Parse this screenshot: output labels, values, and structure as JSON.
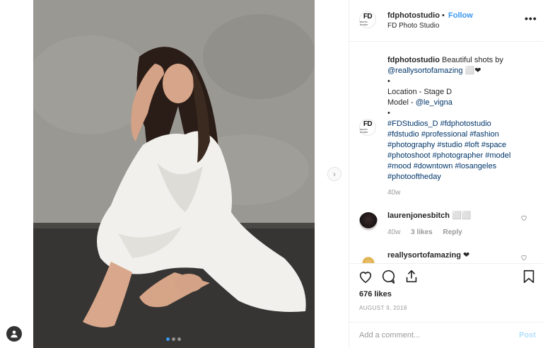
{
  "header": {
    "username": "fdphotostudio",
    "separator": "•",
    "follow_label": "Follow",
    "subtitle": "FD Photo Studio",
    "more_icon": "more-horizontal-icon",
    "logo_text": "FD",
    "logo_small": "PHOTO STUDIO"
  },
  "caption": {
    "username": "fdphotostudio",
    "text_1": "Beautiful shots by",
    "mention_1": "@reallysortofamazing",
    "emoji_1": "⬜❤",
    "bullet": "•",
    "location": "Location - Stage D",
    "model_prefix": "Model - ",
    "model_mention": "@le_vigna",
    "hashtags": [
      "#FDStudios_D #fdphotostudio",
      "#fdstudio #professional #fashion",
      "#photography #studio #loft #space",
      "#photoshoot #photographer #model",
      "#mood #downtown #losangeles",
      "#photooftheday"
    ],
    "time": "40w"
  },
  "comments": [
    {
      "username": "laurenjonesbitch",
      "text": "⬜⬜",
      "time": "40w",
      "likes": "3 likes",
      "reply": "Reply"
    },
    {
      "username": "reallysortofamazing",
      "text": "❤"
    }
  ],
  "actions": {
    "likes": "676 likes",
    "date": "AUGUST 9, 2018",
    "comment_placeholder": "Add a comment...",
    "post_label": "Post"
  },
  "carousel": {
    "dots": 3,
    "active": 0
  },
  "colors": {
    "accent": "#3897f0",
    "link": "#003569",
    "muted": "#999999"
  }
}
